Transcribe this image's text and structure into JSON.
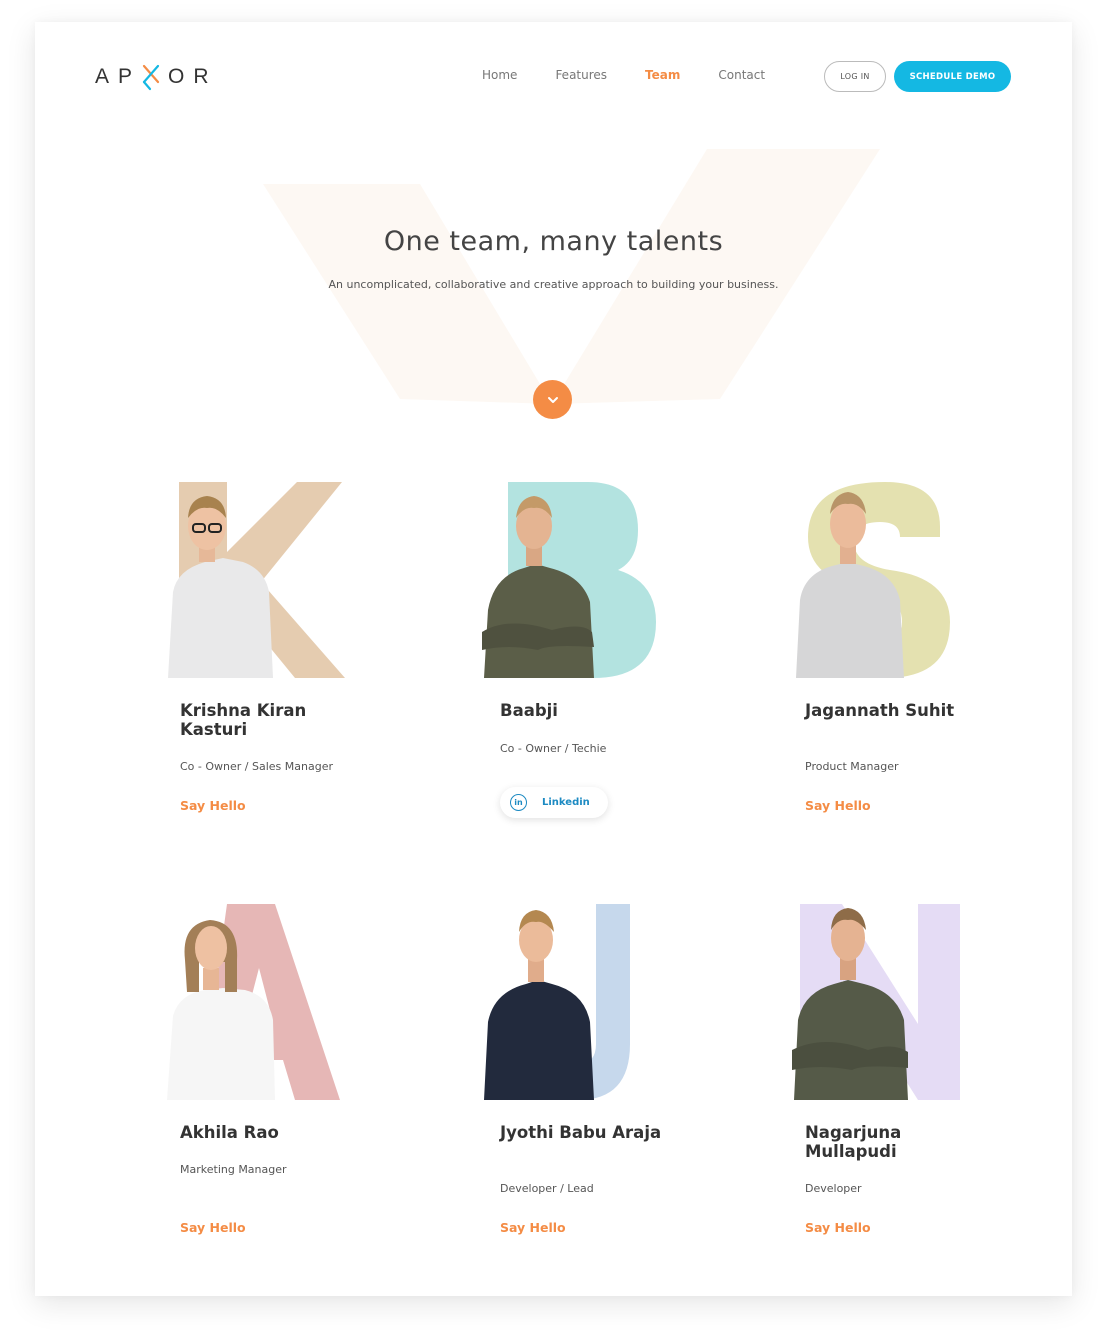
{
  "header": {
    "logo_text": "APXOR",
    "nav": [
      {
        "label": "Home",
        "active": false
      },
      {
        "label": "Features",
        "active": false
      },
      {
        "label": "Team",
        "active": true
      },
      {
        "label": "Contact",
        "active": false
      }
    ],
    "login_label": "LOG IN",
    "demo_label": "SCHEDULE DEMO"
  },
  "hero": {
    "title": "One team, many talents",
    "subtitle": "An uncomplicated, collaborative and creative approach to building your business.",
    "scroll_icon": "chevron-down-icon"
  },
  "team": [
    {
      "letter": "K",
      "letter_color": "#e5ccb0",
      "name": "Krishna Kiran Kasturi",
      "role": "Co - Owner / Sales Manager",
      "action": "Say Hello",
      "shirt": "#e9e9ea"
    },
    {
      "letter": "B",
      "letter_color": "#b3e3e0",
      "name": "Baabji",
      "role": "Co - Owner / Techie",
      "action": "Linkedin",
      "shirt": "#5b5e48"
    },
    {
      "letter": "S",
      "letter_color": "#e4e1b0",
      "name": "Jagannath Suhit",
      "role": "Product Manager",
      "action": "Say Hello",
      "shirt": "#d6d6d7"
    },
    {
      "letter": "A",
      "letter_color": "#e6b7b6",
      "name": "Akhila Rao",
      "role": "Marketing Manager",
      "action": "Say Hello",
      "shirt": "#f6f6f6"
    },
    {
      "letter": "J",
      "letter_color": "#c6d8ec",
      "name": "Jyothi Babu Araja",
      "role": "Developer / Lead",
      "action": "Say Hello",
      "shirt": "#222a3d"
    },
    {
      "letter": "N",
      "letter_color": "#e5dcf5",
      "name": "Nagarjuna Mullapudi",
      "role": "Developer",
      "action": "Say Hello",
      "shirt": "#555a48"
    }
  ],
  "colors": {
    "accent": "#f48c45",
    "primary": "#14b8e3",
    "hero_shape": "#fdf8f3"
  }
}
